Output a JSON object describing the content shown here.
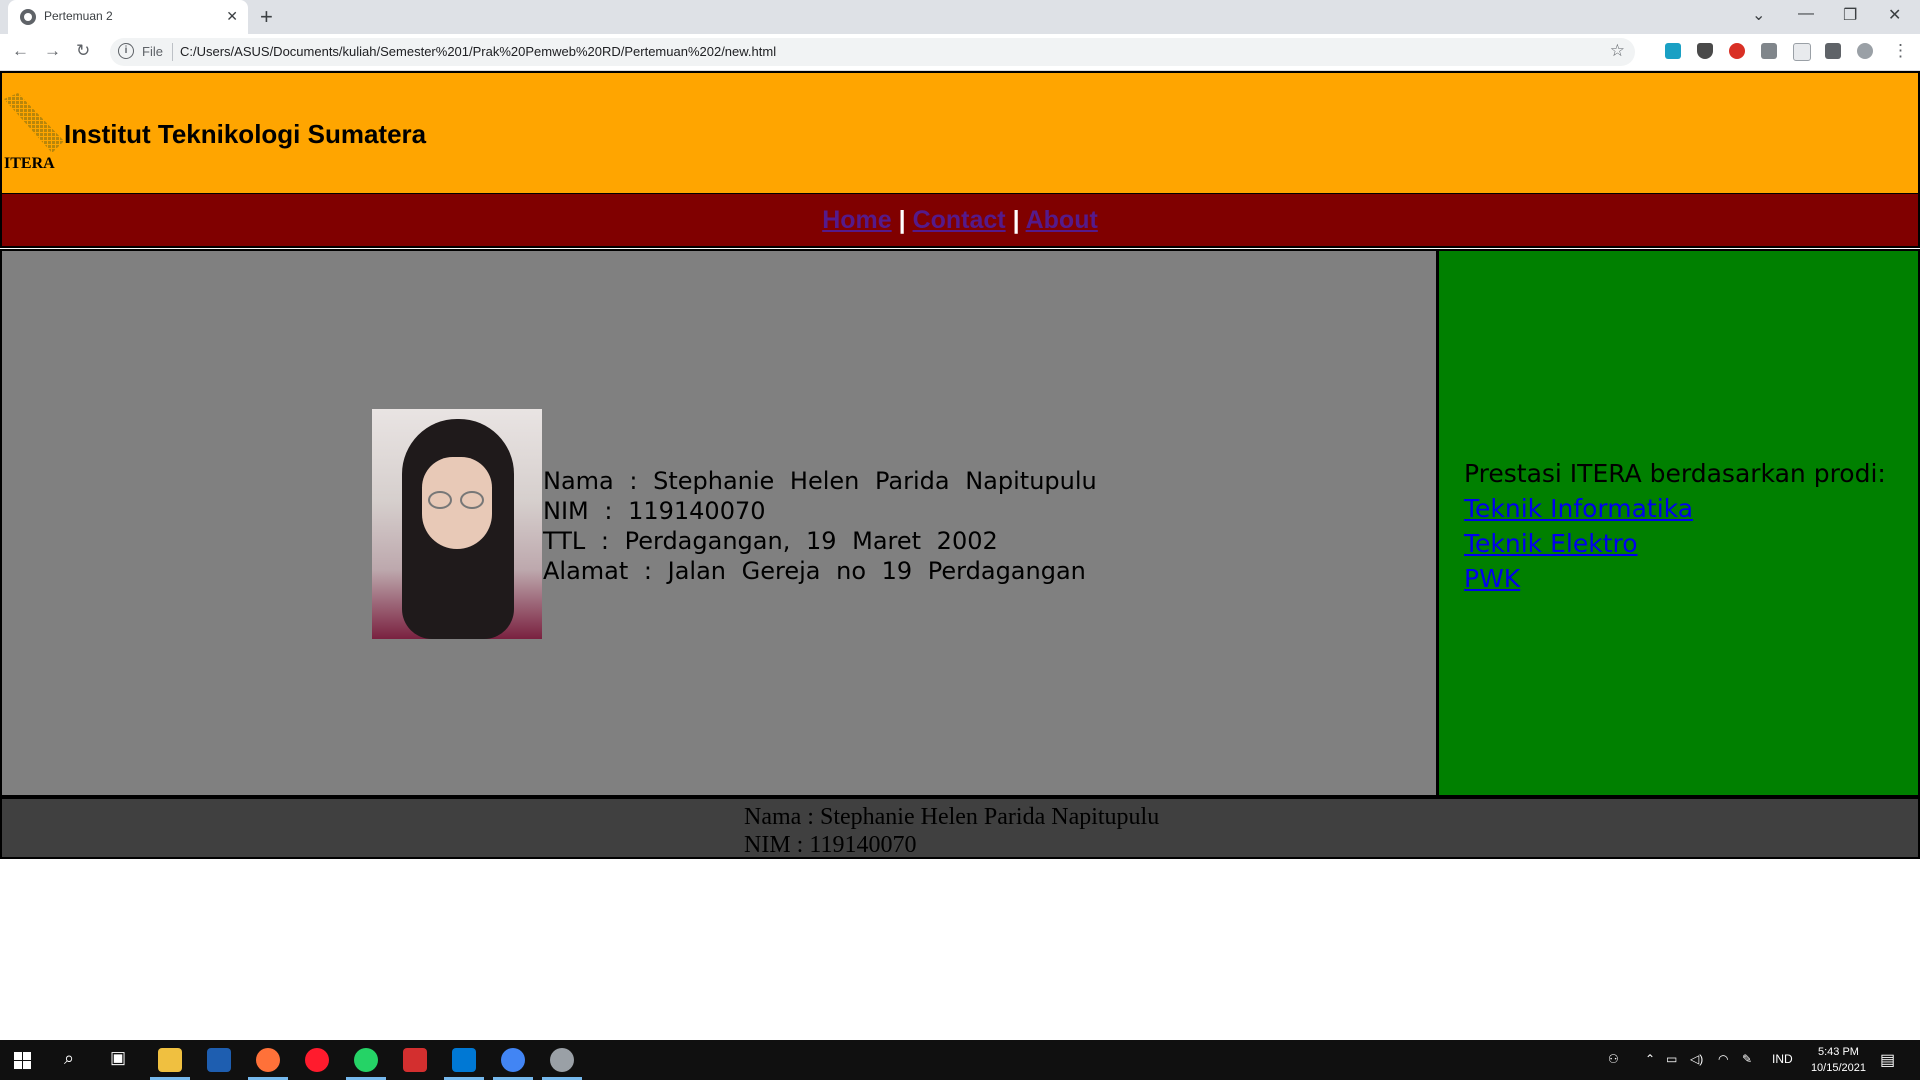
{
  "browser": {
    "tab_title": "Pertemuan 2",
    "file_label": "File",
    "url": "C:/Users/ASUS/Documents/kuliah/Semester%201/Prak%20Pemweb%20RD/Pertemuan%202/new.html"
  },
  "header": {
    "logo_text": "ITERA",
    "title": "Institut Teknikologi Sumatera"
  },
  "nav": {
    "home": "Home",
    "contact": "Contact",
    "about": "About",
    "separator": "|"
  },
  "profile": {
    "nama": "Nama  :  Stephanie  Helen  Parida  Napitupulu",
    "nim": "NIM  :  119140070",
    "ttl": "TTL  :  Perdagangan,  19  Maret  2002",
    "alamat": "Alamat  :  Jalan  Gereja  no  19  Perdagangan"
  },
  "sidebar": {
    "heading": "Prestasi ITERA berdasarkan prodi:",
    "links": [
      "Teknik Informatika",
      "Teknik Elektro",
      "PWK"
    ]
  },
  "footer": {
    "nama": "Nama : Stephanie Helen Parida Napitupulu",
    "nim": "NIM : 119140070"
  },
  "taskbar": {
    "lang": "IND",
    "time": "5:43 PM",
    "date": "10/15/2021"
  },
  "colors": {
    "header_bg": "#ffa500",
    "nav_bg": "#800000",
    "main_bg": "#808080",
    "side_bg": "#008000",
    "footer_bg": "#404040"
  }
}
